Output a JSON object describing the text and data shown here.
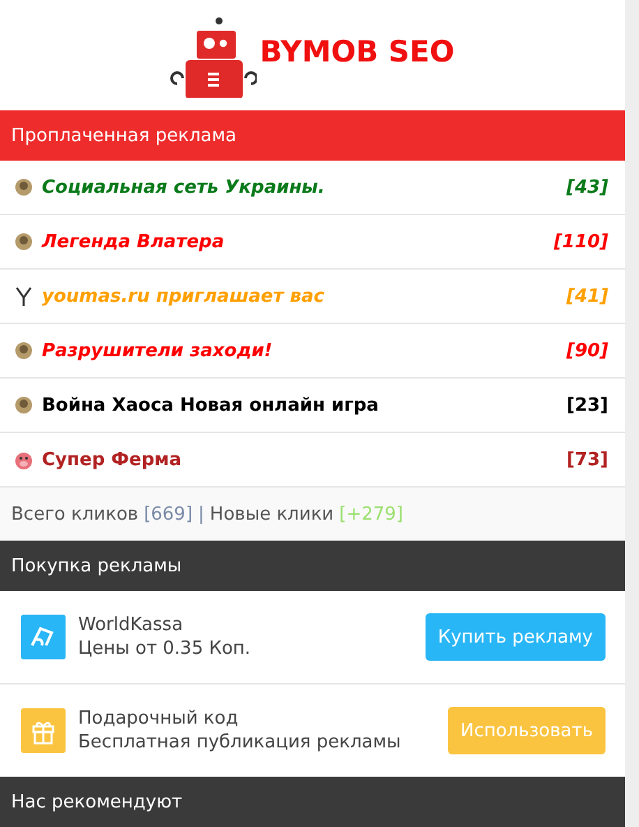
{
  "logo": {
    "text": "BYMOB SEO"
  },
  "paid_ads": {
    "title": "Проплаченная реклама",
    "items": [
      {
        "label": "Социальная сеть Украины.",
        "count": "[43]",
        "color": "#0a7a1a",
        "kind": "italic"
      },
      {
        "label": "Легенда Влатера",
        "count": "[110]",
        "color": "#ff0000",
        "kind": "italic"
      },
      {
        "label": "youmas.ru приглашает вас",
        "count": "[41]",
        "color": "#ffa000",
        "kind": "italic"
      },
      {
        "label": "Разрушители заходи!",
        "count": "[90]",
        "color": "#ff0000",
        "kind": "italic"
      },
      {
        "label": "Война Хаоса Новая онлайн игра",
        "count": "[23]",
        "color": "#000000",
        "kind": "plain"
      },
      {
        "label": "Супер Ферма",
        "count": "[73]",
        "color": "#b22222",
        "kind": "plain"
      }
    ],
    "totals": {
      "label": "Всего кликов",
      "total": "[669]",
      "separator": "|",
      "new_label": "Новые клики",
      "new": "[+279]"
    }
  },
  "buy_ads": {
    "title": "Покупка рекламы",
    "items": [
      {
        "kind": "payment",
        "name": "WorldKassa",
        "detail": "Цены от 0.35 Коп.",
        "button": "Купить рекламу",
        "color": "#29b6f6"
      },
      {
        "kind": "gift",
        "name": "Подарочный код",
        "detail": "Бесплатная публикация рекламы",
        "button": "Использовать",
        "color": "#fbc440"
      }
    ]
  },
  "recommend": {
    "title": "Нас рекомендуют"
  }
}
